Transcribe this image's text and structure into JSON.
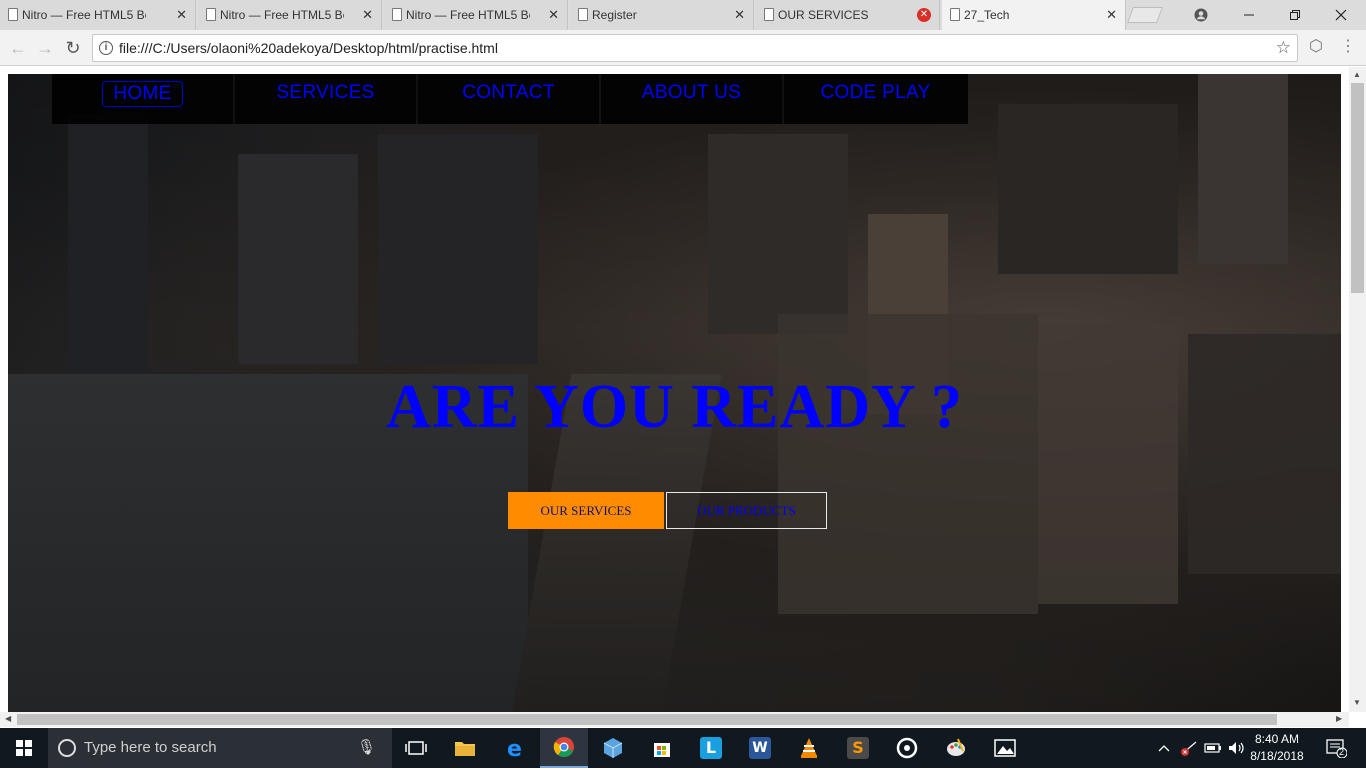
{
  "browser": {
    "tabs": [
      {
        "title": "Nitro — Free HTML5 Bo",
        "close": "✕"
      },
      {
        "title": "Nitro — Free HTML5 Bo",
        "close": "✕"
      },
      {
        "title": "Nitro — Free HTML5 Bo",
        "close": "✕"
      },
      {
        "title": "Register",
        "close": "✕"
      },
      {
        "title": "OUR SERVICES",
        "close": "✕"
      },
      {
        "title": "27_Tech",
        "close": "✕"
      }
    ],
    "url": "file:///C:/Users/olaoni%20adekoya/Desktop/html/practise.html"
  },
  "page": {
    "nav": [
      {
        "label": "HOME"
      },
      {
        "label": "SERVICES"
      },
      {
        "label": "CONTACT"
      },
      {
        "label": "ABOUT US"
      },
      {
        "label": "CODE PLAY"
      }
    ],
    "headline": "ARE YOU READY ?",
    "buttons": {
      "primary": "OUR SERVICES",
      "secondary": "OUR PRODUCTS"
    },
    "colors": {
      "link": "#0000ff",
      "primary_button": "#ff8c00"
    }
  },
  "taskbar": {
    "search_placeholder": "Type here to search",
    "time": "8:40 AM",
    "date": "8/18/2018",
    "notification_count": "2",
    "apps": [
      "task-view",
      "file-explorer",
      "edge",
      "chrome",
      "3d-viewer",
      "store",
      "lync",
      "word",
      "vlc",
      "sublime-text",
      "groove",
      "paint",
      "photos"
    ]
  }
}
